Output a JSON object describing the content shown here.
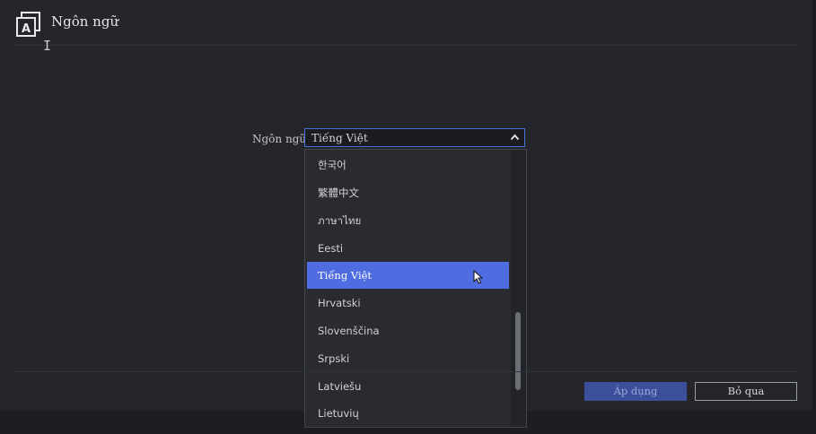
{
  "header": {
    "title": "Ngôn ngữ",
    "icon": "language-icon"
  },
  "form": {
    "label": "Ngôn ngữ",
    "selected_value": "Tiếng Việt"
  },
  "dropdown": {
    "options": [
      {
        "label": "한국어"
      },
      {
        "label": "繁體中文"
      },
      {
        "label": "ภาษาไทย"
      },
      {
        "label": "Eesti"
      },
      {
        "label": "Tiếng Việt",
        "selected": true
      },
      {
        "label": "Hrvatski"
      },
      {
        "label": "Slovenščina"
      },
      {
        "label": "Srpski"
      },
      {
        "label": "Latviešu"
      },
      {
        "label": "Lietuvių"
      }
    ]
  },
  "footer": {
    "apply_label": "Áp dụng",
    "skip_label": "Bỏ qua"
  },
  "colors": {
    "accent": "#4f6de0",
    "panel": "#25262b",
    "apply_button": "#3b4f9a"
  }
}
